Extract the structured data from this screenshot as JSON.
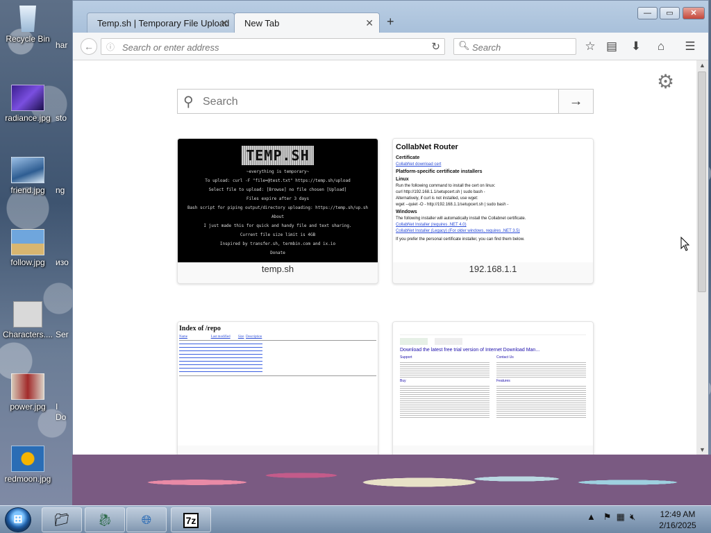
{
  "desktop": {
    "icons": [
      {
        "label": "Recycle Bin"
      },
      {
        "label": "radiance.jpg"
      },
      {
        "label": "friend.jpg"
      },
      {
        "label": "follow.jpg"
      },
      {
        "label": "Characters...."
      },
      {
        "label": "power.jpg"
      },
      {
        "label": "redmoon.jpg"
      }
    ],
    "partial_labels": [
      "har",
      "sto",
      "ng",
      "изо",
      "Ser",
      "I",
      "Do"
    ]
  },
  "browser": {
    "tabs": [
      {
        "title": "Temp.sh | Temporary File Upload",
        "active": false
      },
      {
        "title": "New Tab",
        "active": true
      }
    ],
    "new_tab_symbol": "+",
    "window_controls": {
      "minimize": "—",
      "maximize": "▭",
      "close": "✕"
    },
    "address_bar": {
      "placeholder": "Search or enter address"
    },
    "search_bar": {
      "placeholder": "Search"
    },
    "toolbar_icons": [
      "star-icon",
      "reading-list-icon",
      "download-icon",
      "home-icon",
      "menu-icon"
    ]
  },
  "new_tab_page": {
    "search_placeholder": "Search",
    "tiles": [
      {
        "title": "temp.sh",
        "preview": {
          "logo": "TEMP.SH",
          "lines": [
            "~everything is temporary~",
            "To upload: curl -F \"file=@test.txt\" https://temp.sh/upload",
            "Select file to upload: [Browse] no file chosen [Upload]",
            "Files expire after 3 days",
            "Bash script for piping output/directory uploading: https://temp.sh/up.sh",
            "About",
            "I just made this for quick and handy file and text sharing.",
            "Current file size limit is 4GB",
            "Inspired by transfer.sh, termbin.com and ix.io",
            "Donate"
          ]
        }
      },
      {
        "title": "192.168.1.1",
        "preview": {
          "heading": "CollabNet Router",
          "sections": [
            "Certificate",
            "Platform-specific certificate installers",
            "Linux",
            "Windows"
          ],
          "lines": [
            "CollabNet download cert",
            "Run the following command to install the cert on linux:",
            "curl http://192.168.1.1/setupcert.sh | sudo bash -",
            "Alternatively, if curl is not installed, use wget:",
            "wget --quiet -O - http://192.168.1.1/setupcert.sh | sudo bash -",
            "The following installer will automatically install the Collabnet certificate.",
            "CollabNet Installer (requires .NET 4.0)",
            "CollabNet Installer (Legacy) (For older windows, requires .NET 3.5)",
            "If you prefer the personal certificate installer, you can find them below."
          ]
        }
      },
      {
        "title": "",
        "preview": {
          "heading": "Index of /repo",
          "columns": [
            "Name",
            "Last modified",
            "Size",
            "Description"
          ],
          "rows": 9
        }
      },
      {
        "title": "",
        "preview": {
          "result_title": "Download the latest free trial version of Internet Download Man...",
          "sections": [
            "Support",
            "Contact Us",
            "Buy",
            "Features"
          ]
        }
      }
    ]
  },
  "taskbar": {
    "apps": [
      "windows-explorer",
      "dragon-app",
      "internet-download-manager",
      "7zip"
    ],
    "app_labels": {
      "7zip": "7z"
    },
    "clock": {
      "time": "12:49 AM",
      "date": "2/16/2025"
    }
  }
}
